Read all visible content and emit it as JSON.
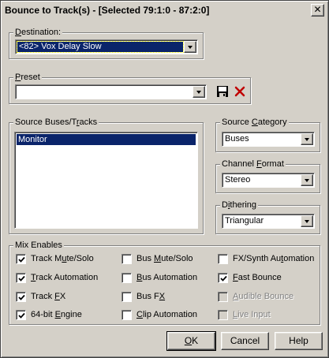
{
  "window": {
    "title": "Bounce to Track(s) - [Selected 79:1:0 - 87:2:0]",
    "close_glyph": "✕"
  },
  "destination": {
    "label_hot": "D",
    "label_rest": "estination:",
    "value": "<82> Vox Delay Slow"
  },
  "preset": {
    "label_hot": "P",
    "label_rest": "reset",
    "value": "",
    "save_icon": "save-icon",
    "delete_icon": "delete-icon",
    "delete_color": "#c00000"
  },
  "source_tracks": {
    "label_pre": "Source Buses/T",
    "label_hot": "r",
    "label_post": "acks",
    "items": [
      "Monitor"
    ]
  },
  "source_category": {
    "label_pre": "Source ",
    "label_hot": "C",
    "label_post": "ategory",
    "value": "Buses"
  },
  "channel_format": {
    "label_pre": "Channel ",
    "label_hot": "F",
    "label_post": "ormat",
    "value": "Stereo"
  },
  "dithering": {
    "label_pre": "D",
    "label_hot": "i",
    "label_post": "thering",
    "value": "Triangular"
  },
  "mix_enables": {
    "label": "Mix Enables",
    "options": [
      {
        "pre": "Track M",
        "hot": "u",
        "post": "te/Solo",
        "checked": true,
        "enabled": true
      },
      {
        "pre": "",
        "hot": "T",
        "post": "rack Automation",
        "checked": true,
        "enabled": true
      },
      {
        "pre": "Track ",
        "hot": "F",
        "post": "X",
        "checked": true,
        "enabled": true
      },
      {
        "pre": "64-bit ",
        "hot": "E",
        "post": "ngine",
        "checked": true,
        "enabled": true
      },
      {
        "pre": "Bus ",
        "hot": "M",
        "post": "ute/Solo",
        "checked": false,
        "enabled": true
      },
      {
        "pre": "",
        "hot": "B",
        "post": "us Automation",
        "checked": false,
        "enabled": true
      },
      {
        "pre": "Bus F",
        "hot": "X",
        "post": "",
        "checked": false,
        "enabled": true
      },
      {
        "pre": "",
        "hot": "C",
        "post": "lip Automation",
        "checked": false,
        "enabled": true
      },
      {
        "pre": "FX/Synth Au",
        "hot": "t",
        "post": "omation",
        "checked": false,
        "enabled": true
      },
      {
        "pre": "",
        "hot": "F",
        "post": "ast Bounce",
        "checked": true,
        "enabled": true
      },
      {
        "pre": "",
        "hot": "A",
        "post": "udible Bounce",
        "checked": false,
        "enabled": false
      },
      {
        "pre": "",
        "hot": "L",
        "post": "ive Input",
        "checked": false,
        "enabled": false
      }
    ]
  },
  "buttons": {
    "ok_hot": "O",
    "ok_rest": "K",
    "cancel": "Cancel",
    "help": "Help"
  }
}
